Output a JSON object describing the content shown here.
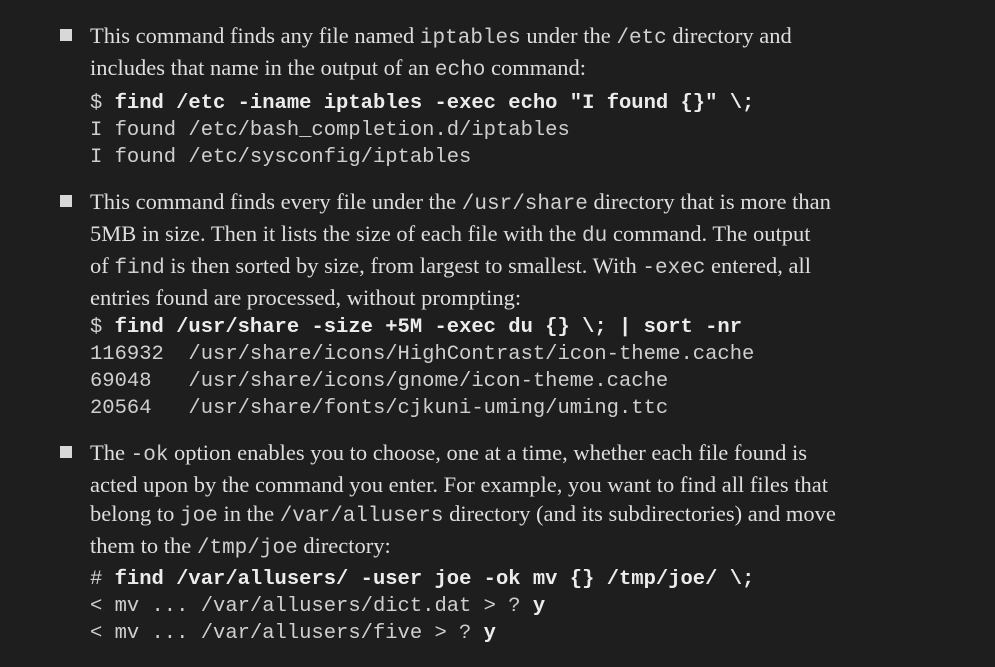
{
  "items": [
    {
      "lines": [
        [
          "This command finds any file named ",
          "iptables",
          " under the ",
          "/etc",
          " directory and"
        ],
        [
          "includes that name in the output of an ",
          "echo",
          " command:"
        ]
      ],
      "code": {
        "prompt": "$ ",
        "command": "find /etc -iname iptables -exec echo \"I found {}\" \\;",
        "output": [
          "I found /etc/bash_completion.d/iptables",
          "I found /etc/sysconfig/iptables"
        ]
      }
    },
    {
      "lines": [
        [
          "This command finds every file under the ",
          "/usr/share",
          " directory that is more than"
        ],
        [
          "5MB in size. Then it lists the size of each file with the ",
          "du",
          " command. The output"
        ],
        [
          "of ",
          "find",
          " is then sorted by size, from largest to smallest. With ",
          "-exec",
          " entered, all"
        ],
        [
          "entries found are processed, without prompting:"
        ]
      ],
      "code": {
        "prompt": "$ ",
        "command": "find /usr/share -size +5M -exec du {} \\; | sort -nr",
        "output": [
          "116932  /usr/share/icons/HighContrast/icon-theme.cache",
          "69048   /usr/share/icons/gnome/icon-theme.cache",
          "20564   /usr/share/fonts/cjkuni-uming/uming.ttc"
        ]
      }
    },
    {
      "lines": [
        [
          "The ",
          "-ok",
          " option enables you to choose, one at a time, whether each file found is"
        ],
        [
          "acted upon by the command you enter. For example, you want to find all files that"
        ],
        [
          "belong to ",
          "joe",
          " in the ",
          "/var/allusers",
          " directory (and its subdirectories) and move"
        ],
        [
          "them to the ",
          "/tmp/joe",
          " directory:"
        ]
      ],
      "code": {
        "prompt": "# ",
        "command": "find /var/allusers/ -user joe -ok mv {} /tmp/joe/ \\;",
        "output": [
          "< mv ... /var/allusers/dict.dat > ? ",
          "< mv ... /var/allusers/five > ? "
        ],
        "answers": [
          "y",
          "y"
        ]
      }
    }
  ]
}
